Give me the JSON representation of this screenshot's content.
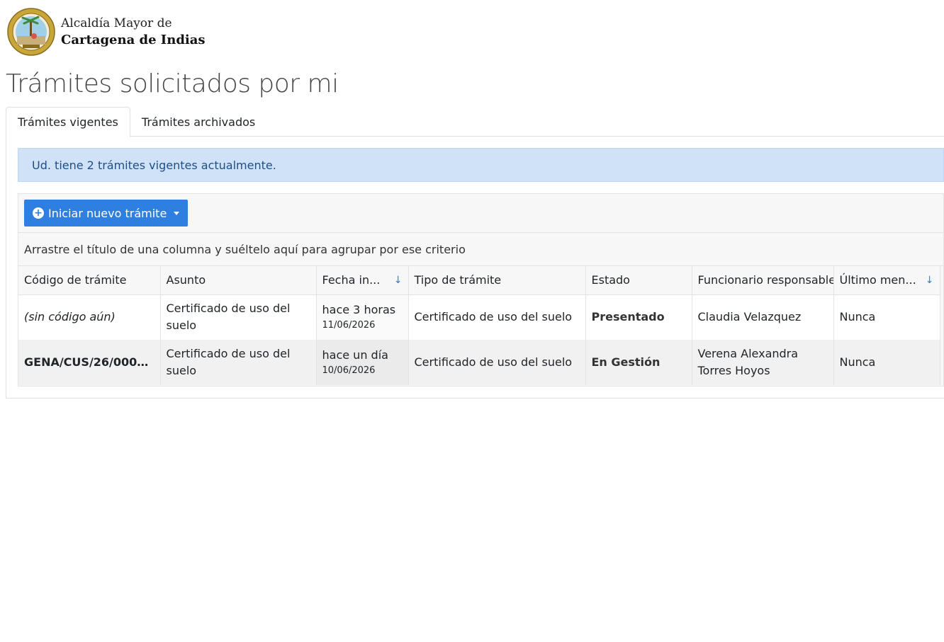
{
  "header": {
    "brand_line1": "Alcaldía Mayor de",
    "brand_line2": "Cartagena de Indias",
    "seal_icon": "city-seal-icon"
  },
  "page": {
    "title": "Trámites solicitados por mi"
  },
  "tabs": [
    {
      "label": "Trámites vigentes",
      "active": true
    },
    {
      "label": "Trámites archivados",
      "active": false
    }
  ],
  "alert": {
    "text": "Ud. tiene 2 trámites vigentes actualmente."
  },
  "toolbar": {
    "new_button_label": "Iniciar nuevo trámite"
  },
  "grid": {
    "group_hint": "Arrastre el título de una columna y suéltelo aquí para agrupar por ese criterio",
    "columns": [
      {
        "label": "Código de trámite",
        "sorted": false
      },
      {
        "label": "Asunto",
        "sorted": false
      },
      {
        "label": "Fecha in...",
        "sorted": true
      },
      {
        "label": "Tipo de trámite",
        "sorted": false
      },
      {
        "label": "Estado",
        "sorted": false
      },
      {
        "label": "Funcionario responsable",
        "sorted": false
      },
      {
        "label": "Último men...",
        "sorted": true
      }
    ],
    "sort_arrow": "↓",
    "rows": [
      {
        "codigo": "(sin código aún)",
        "asunto": "Certificado de uso del suelo",
        "fecha_rel": "hace 3 horas",
        "fecha": "11/06/2026",
        "tipo": "Certificado de uso del suelo",
        "estado": "Presentado",
        "funcionario": "Claudia Velazquez",
        "ultimo": "Nunca"
      },
      {
        "codigo": "GENA/CUS/26/00000...",
        "asunto": "Certificado de uso del suelo",
        "fecha_rel": "hace un día",
        "fecha": "10/06/2026",
        "tipo": "Certificado de uso del suelo",
        "estado": "En Gestión",
        "funcionario": "Verena Alexandra Torres Hoyos",
        "ultimo": "Nunca"
      }
    ]
  },
  "colors": {
    "primary": "#2f7fe0",
    "alert_bg": "#cfe2f8",
    "alert_text": "#1f4f86"
  }
}
